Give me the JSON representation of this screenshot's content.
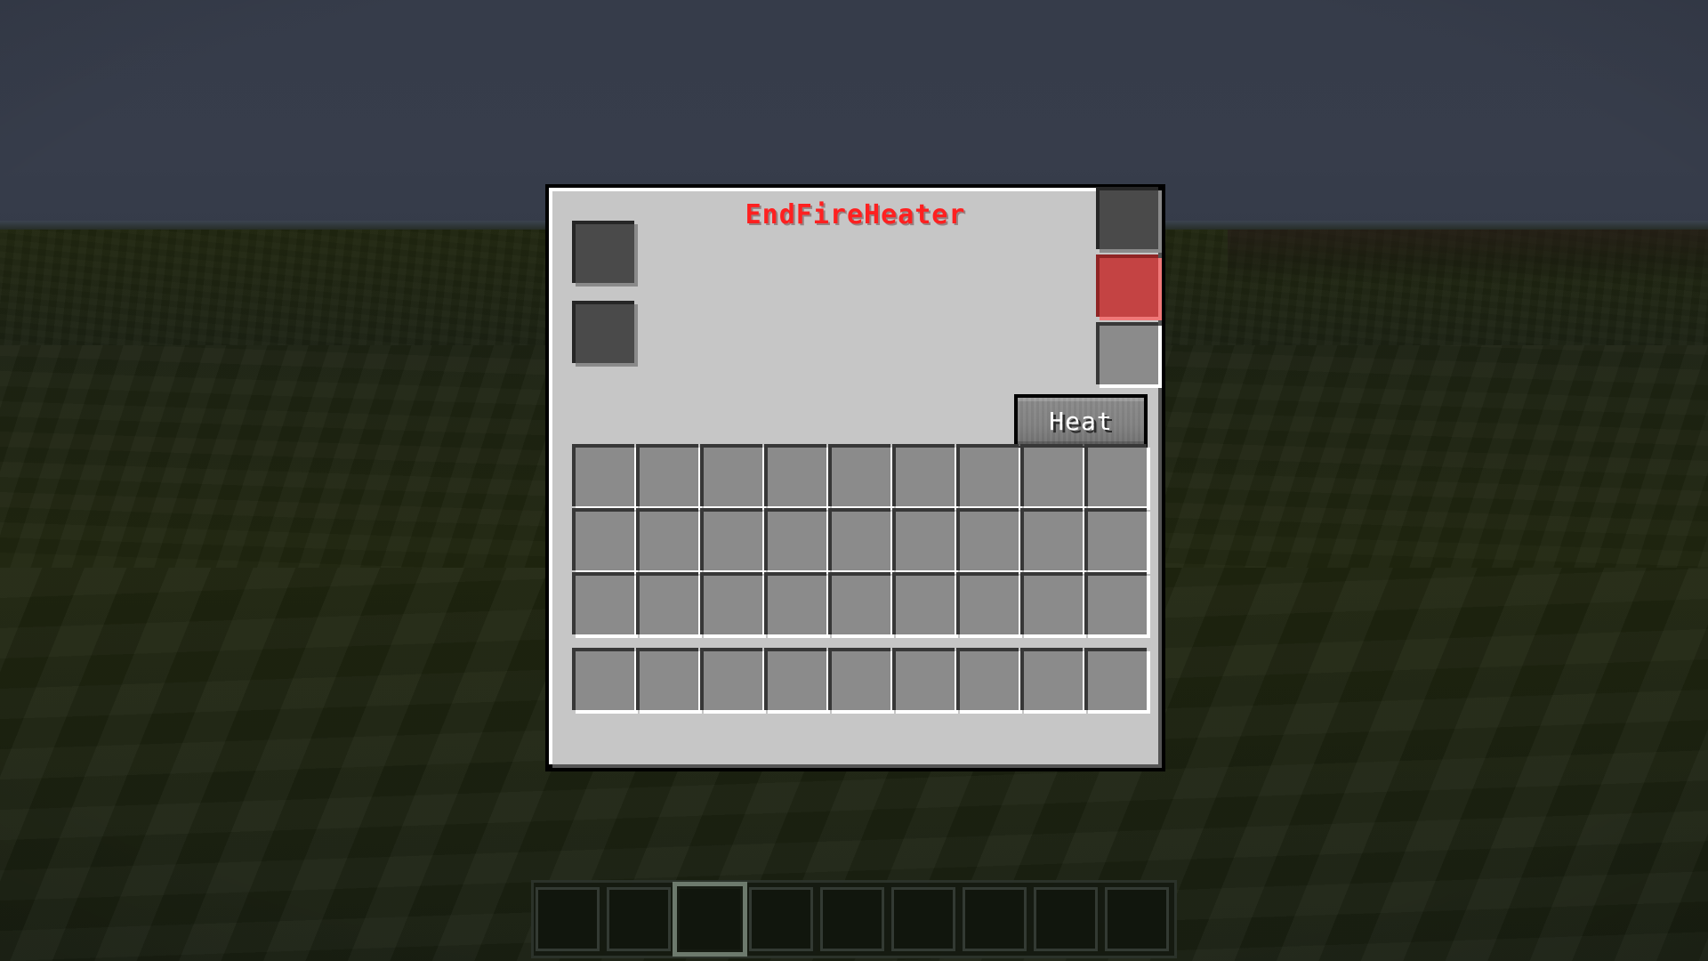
{
  "window": {
    "title": "EndFireHeater",
    "title_color": "#ff2020",
    "panel_bg_color": "#c6c6c6"
  },
  "machine": {
    "input_slots": [
      {
        "name": "input-slot-1",
        "state": "empty",
        "color": "#4a4a4a"
      },
      {
        "name": "input-slot-2",
        "state": "empty",
        "color": "#4a4a4a"
      }
    ],
    "output_slots": [
      {
        "name": "output-slot-1",
        "state": "empty",
        "color": "#4a4a4a"
      },
      {
        "name": "status-slot-red",
        "state": "active",
        "color": "#c44343"
      },
      {
        "name": "output-slot-2",
        "state": "empty",
        "color": "#8b8b8b"
      }
    ],
    "heat_button": {
      "label": "Heat",
      "text_color": "#ffffff",
      "face_color": "#828282"
    }
  },
  "player_inventory": {
    "columns": 9,
    "main_rows": 3,
    "hotbar_slots": 9,
    "slot_fill_color": "#8b8b8b",
    "rows": [
      [
        "",
        "",
        "",
        "",
        "",
        "",
        "",
        "",
        ""
      ],
      [
        "",
        "",
        "",
        "",
        "",
        "",
        "",
        "",
        ""
      ],
      [
        "",
        "",
        "",
        "",
        "",
        "",
        "",
        "",
        ""
      ]
    ],
    "hotbar": [
      "",
      "",
      "",
      "",
      "",
      "",
      "",
      "",
      ""
    ]
  },
  "hud": {
    "hotbar_slots": [
      "",
      "",
      "",
      "",
      "",
      "",
      "",
      "",
      ""
    ],
    "selected_slot_index": 2,
    "slot_bg_color": "#11160d"
  },
  "scene": {
    "sky_color": "#363c4a",
    "ground_color": "#1e2415",
    "time_of_day": "night"
  }
}
